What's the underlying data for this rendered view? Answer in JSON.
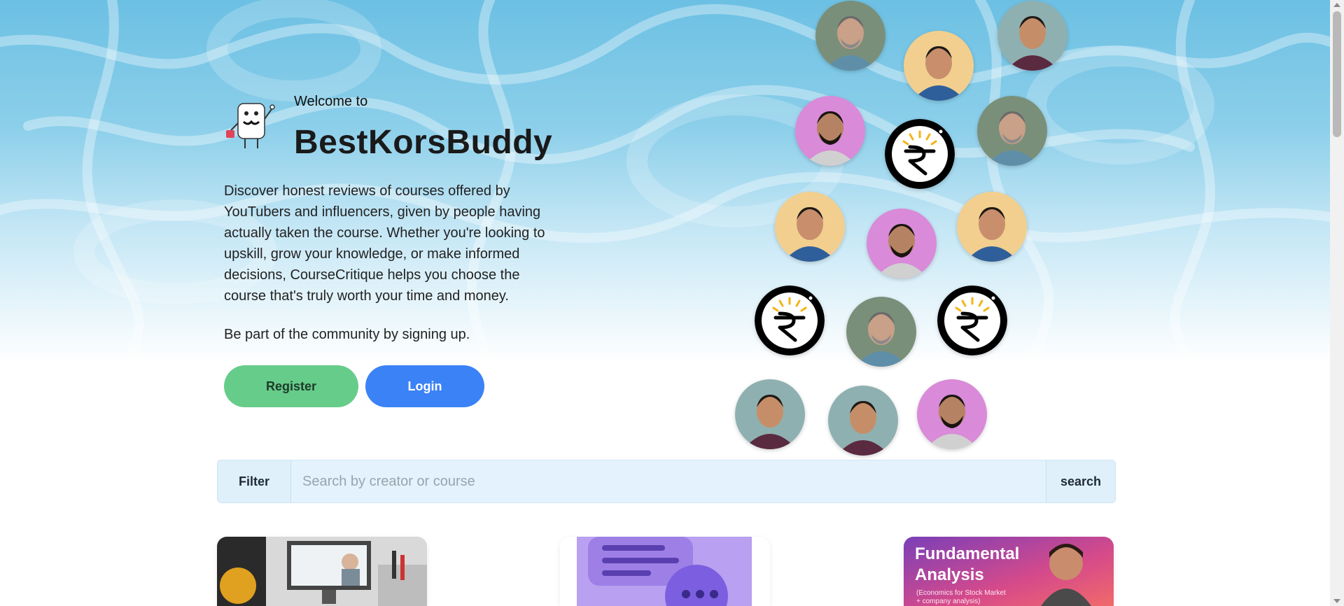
{
  "hero": {
    "welcome": "Welcome to",
    "brand": "BestKorsBuddy",
    "description": "Discover honest reviews of courses offered by YouTubers and influencers, given by people having actually taken the course. Whether you're looking to upskill, grow your knowledge, or make informed decisions, CourseCritique helps you choose the course that's truly worth your time and money.",
    "signup_text": "Be part of the community by signing up.",
    "register_label": "Register",
    "login_label": "Login"
  },
  "creators": [
    {
      "type": "photo",
      "variant": "grey-beard"
    },
    {
      "type": "photo",
      "variant": "young-blue"
    },
    {
      "type": "photo",
      "variant": "young-maroon"
    },
    {
      "type": "photo",
      "variant": "beard-pink"
    },
    {
      "type": "logo",
      "variant": "rupee"
    },
    {
      "type": "photo",
      "variant": "grey-beard"
    },
    {
      "type": "photo",
      "variant": "young-blue"
    },
    {
      "type": "photo",
      "variant": "beard-pink"
    },
    {
      "type": "photo",
      "variant": "young-blue"
    },
    {
      "type": "logo",
      "variant": "rupee"
    },
    {
      "type": "photo",
      "variant": "grey-beard"
    },
    {
      "type": "logo",
      "variant": "rupee"
    },
    {
      "type": "photo",
      "variant": "young-maroon"
    },
    {
      "type": "photo",
      "variant": "young-maroon"
    },
    {
      "type": "photo",
      "variant": "beard-pink"
    }
  ],
  "search": {
    "filter_label": "Filter",
    "placeholder": "Search by creator or course",
    "search_label": "search"
  },
  "cards": [
    {
      "image": "online-class"
    },
    {
      "image": "chat-bubbles"
    },
    {
      "image": "fundamental-analysis",
      "title": "Fundamental Analysis",
      "subtitle": "(Economics for Stock Market + company analysis)"
    }
  ],
  "colors": {
    "register": "#66cc8a",
    "login": "#3b82f6",
    "search_bg": "#dff0fb",
    "hero_top": "#6cc0e3"
  }
}
